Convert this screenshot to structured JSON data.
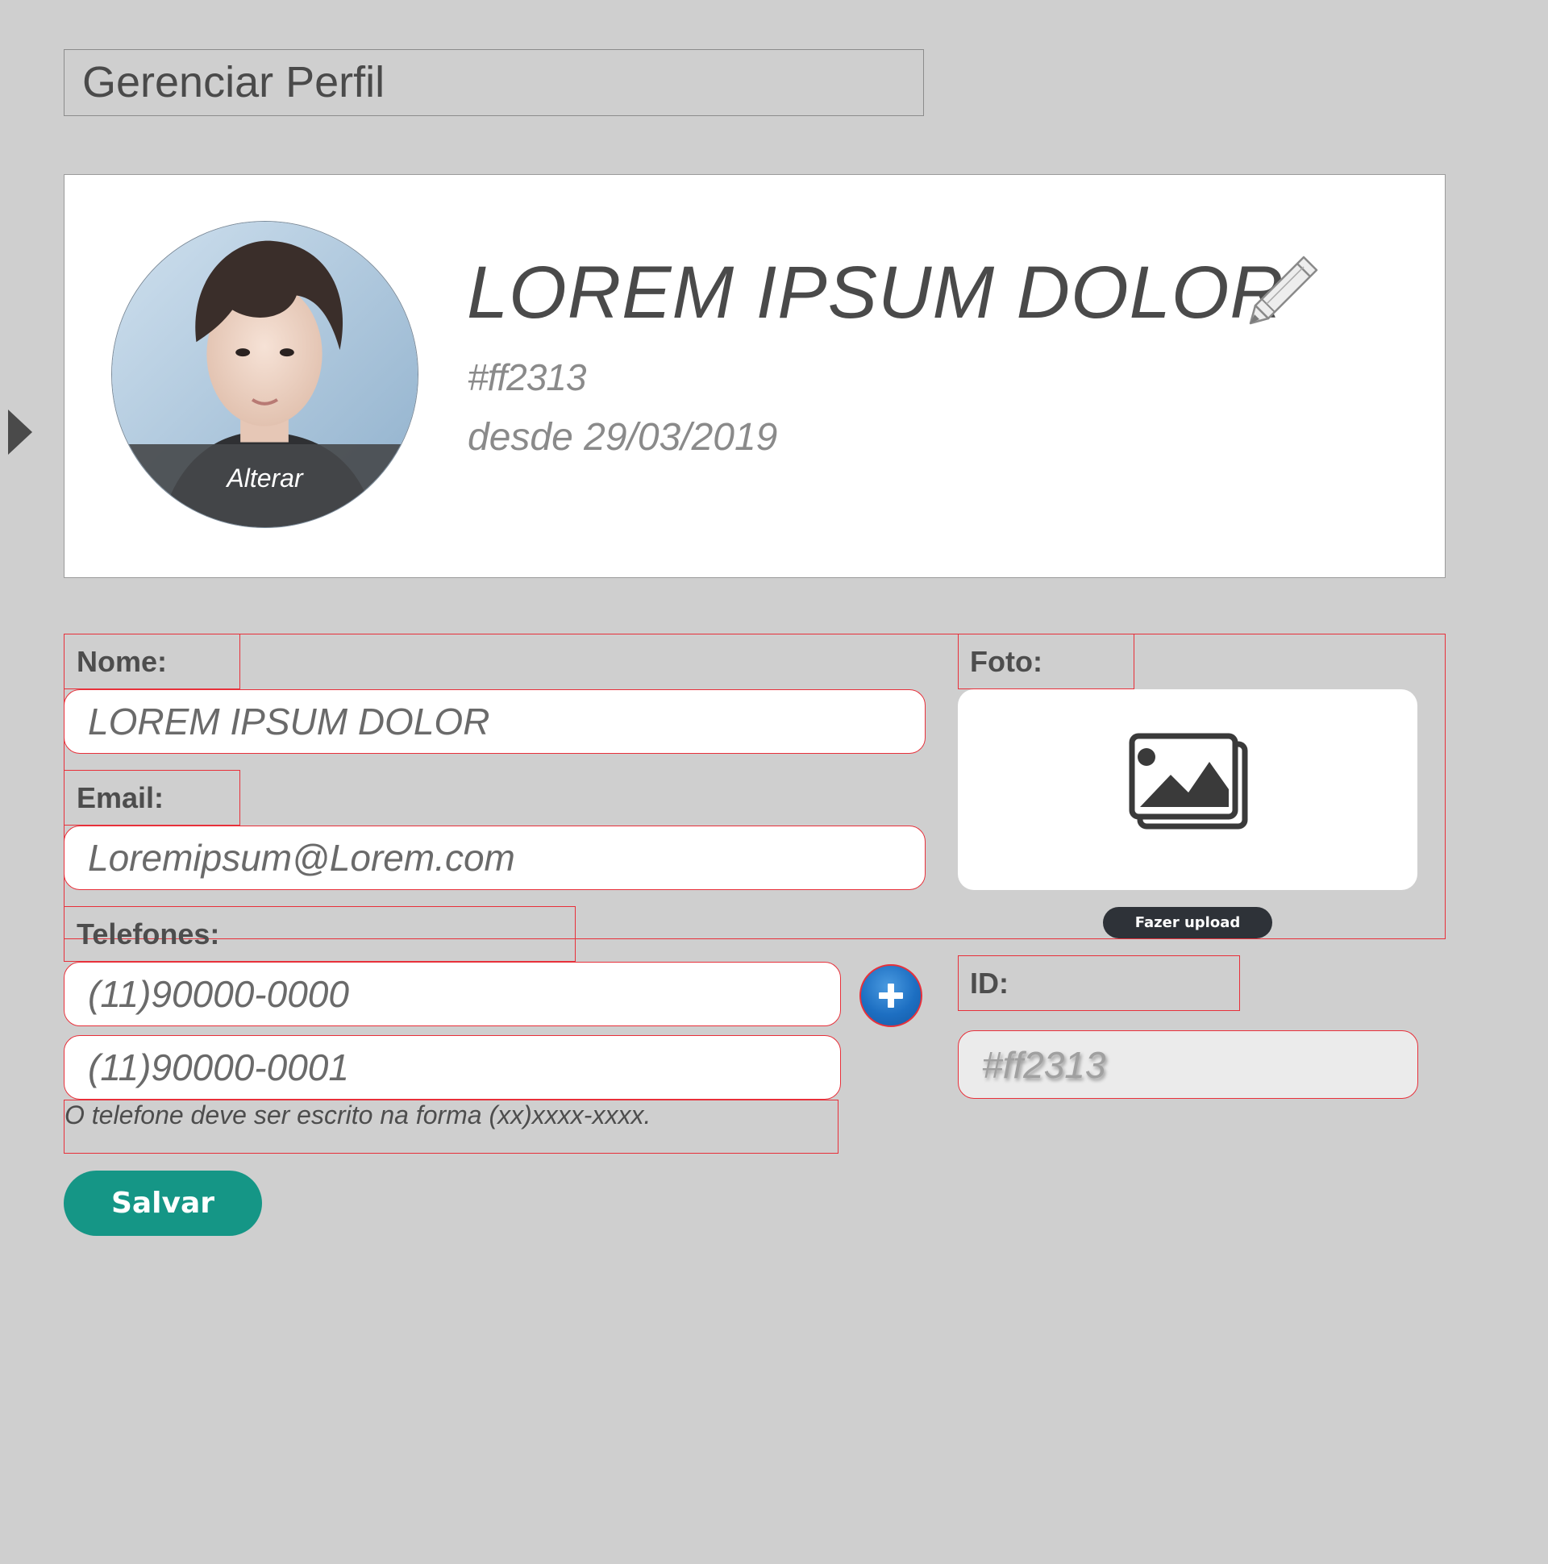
{
  "header": {
    "title": "Gerenciar Perfil"
  },
  "profile": {
    "name": "LOREM IPSUM DOLOR",
    "id": "#ff2313",
    "since": "desde 29/03/2019",
    "avatar_change_label": "Alterar"
  },
  "form": {
    "name_label": "Nome:",
    "name_value": "LOREM IPSUM DOLOR",
    "email_label": "Email:",
    "email_value": "Loremipsum@Lorem.com",
    "phones_label": "Telefones:",
    "phones": [
      "(11)90000-0000",
      "(11)90000-0001"
    ],
    "phone_hint": "O telefone deve ser escrito na forma (xx)xxxx-xxxx.",
    "photo_label": "Foto:",
    "upload_label": "Fazer upload",
    "id_label": "ID:",
    "id_value": "#ff2313",
    "save_label": "Salvar"
  },
  "icons": {
    "expand": "caret-right-icon",
    "edit": "pencil-icon",
    "image": "image-gallery-icon",
    "add": "plus-icon"
  },
  "colors": {
    "background": "#cfcfcf",
    "card": "#ffffff",
    "text": "#4d4d4d",
    "muted_text": "#8a8a8a",
    "outline": "#e8303a",
    "save_button": "#159686",
    "add_button": "#1d6fc2",
    "upload_button": "#2e3238"
  }
}
